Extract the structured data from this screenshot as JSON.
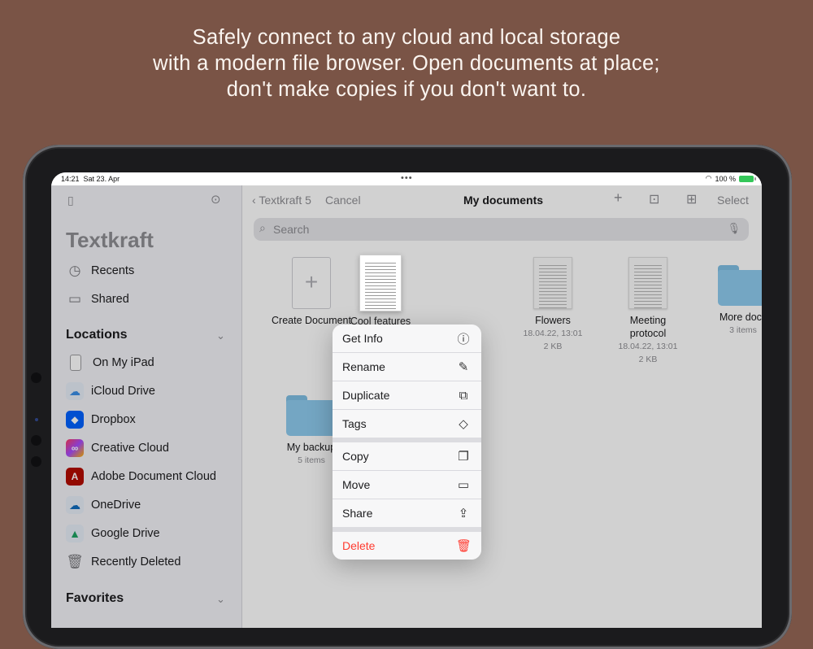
{
  "headline": {
    "line1": "Safely connect to any cloud and local storage",
    "line2": "with a modern file browser. Open documents  at place;",
    "line3": "don't make copies if you don't want to."
  },
  "status": {
    "time": "14:21",
    "date": "Sat 23. Apr",
    "battery": "100 %"
  },
  "sidebar": {
    "app_title": "Textkraft",
    "top_items": [
      {
        "label": "Recents",
        "icon": "clock-icon"
      },
      {
        "label": "Shared",
        "icon": "shared-folder-icon"
      }
    ],
    "locations_header": "Locations",
    "locations": [
      {
        "label": "On My iPad",
        "icon": "ipad-icon",
        "color": "#d0d0d4"
      },
      {
        "label": "iCloud Drive",
        "icon": "icloud-icon",
        "color": "#e8eef6"
      },
      {
        "label": "Dropbox",
        "icon": "dropbox-icon",
        "color": "#0061fe"
      },
      {
        "label": "Creative Cloud",
        "icon": "creative-cloud-icon",
        "color": "#da1f26"
      },
      {
        "label": "Adobe Document Cloud",
        "icon": "adobe-acrobat-icon",
        "color": "#b30b00"
      },
      {
        "label": "OneDrive",
        "icon": "onedrive-icon",
        "color": "#e8eef6"
      },
      {
        "label": "Google Drive",
        "icon": "google-drive-icon",
        "color": "#e8eef6"
      },
      {
        "label": "Recently Deleted",
        "icon": "trash-icon",
        "color": "#f2f2f7"
      }
    ],
    "favorites_header": "Favorites"
  },
  "navbar": {
    "back": "Textkraft 5",
    "cancel": "Cancel",
    "title": "My documents",
    "select": "Select"
  },
  "search": {
    "placeholder": "Search"
  },
  "files": {
    "create": {
      "name": "Create Document"
    },
    "cool": {
      "name": "Cool features"
    },
    "flowers": {
      "name": "Flowers",
      "date": "18.04.22, 13:01",
      "size": "2 KB"
    },
    "meeting": {
      "name": "Meeting protocol",
      "date": "18.04.22, 13:01",
      "size": "2 KB"
    },
    "moredocs": {
      "name": "More docs",
      "count": "3 items"
    },
    "backup": {
      "name": "My backup",
      "count": "5 items"
    }
  },
  "menu": {
    "get_info": "Get Info",
    "rename": "Rename",
    "duplicate": "Duplicate",
    "tags": "Tags",
    "copy": "Copy",
    "move": "Move",
    "share": "Share",
    "delete": "Delete"
  }
}
